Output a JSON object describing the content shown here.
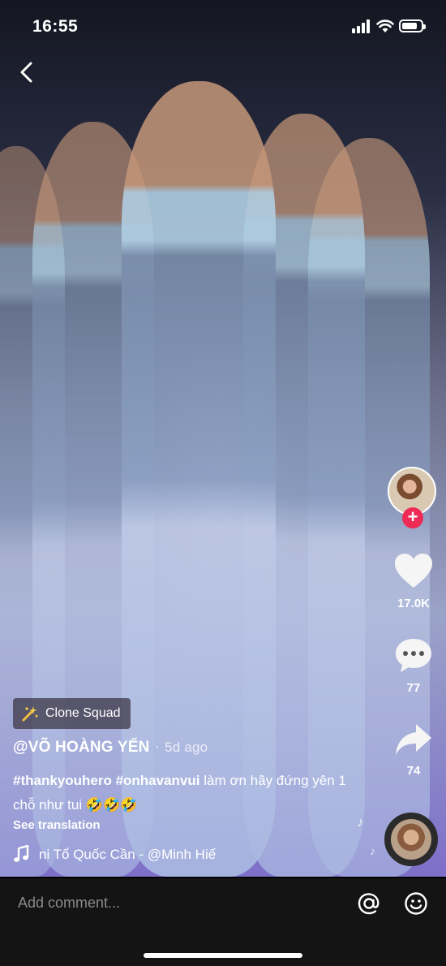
{
  "status_bar": {
    "time": "16:55",
    "battery_level": 0.8
  },
  "effect": {
    "label": "Clone Squad"
  },
  "post": {
    "username": "@VÕ HOÀNG YẾN",
    "separator": "·",
    "time_ago": "5d ago",
    "caption_tags": "#thankyouhero #onhavanvui",
    "caption_text": " làm ơn hãy đứng yên 1 chỗ như tui 🤣🤣🤣",
    "see_translation": "See translation"
  },
  "music": {
    "title": "ni Tổ Quốc Cần - @Minh Hiế"
  },
  "actions": {
    "likes": "17.0K",
    "comments": "77",
    "shares": "74",
    "follow_symbol": "+"
  },
  "comment_bar": {
    "placeholder": "Add comment..."
  },
  "icons": {
    "back": "chevron-left-icon",
    "like": "heart-icon",
    "comment": "speech-bubble-icon",
    "share": "share-arrow-icon",
    "at": "at-sign-icon",
    "emoji": "smiley-icon",
    "music": "music-note-icon",
    "effect": "sparkle-wand-icon"
  },
  "colors": {
    "follow_badge": "#ee2b55",
    "comment_bar": "#141414"
  }
}
